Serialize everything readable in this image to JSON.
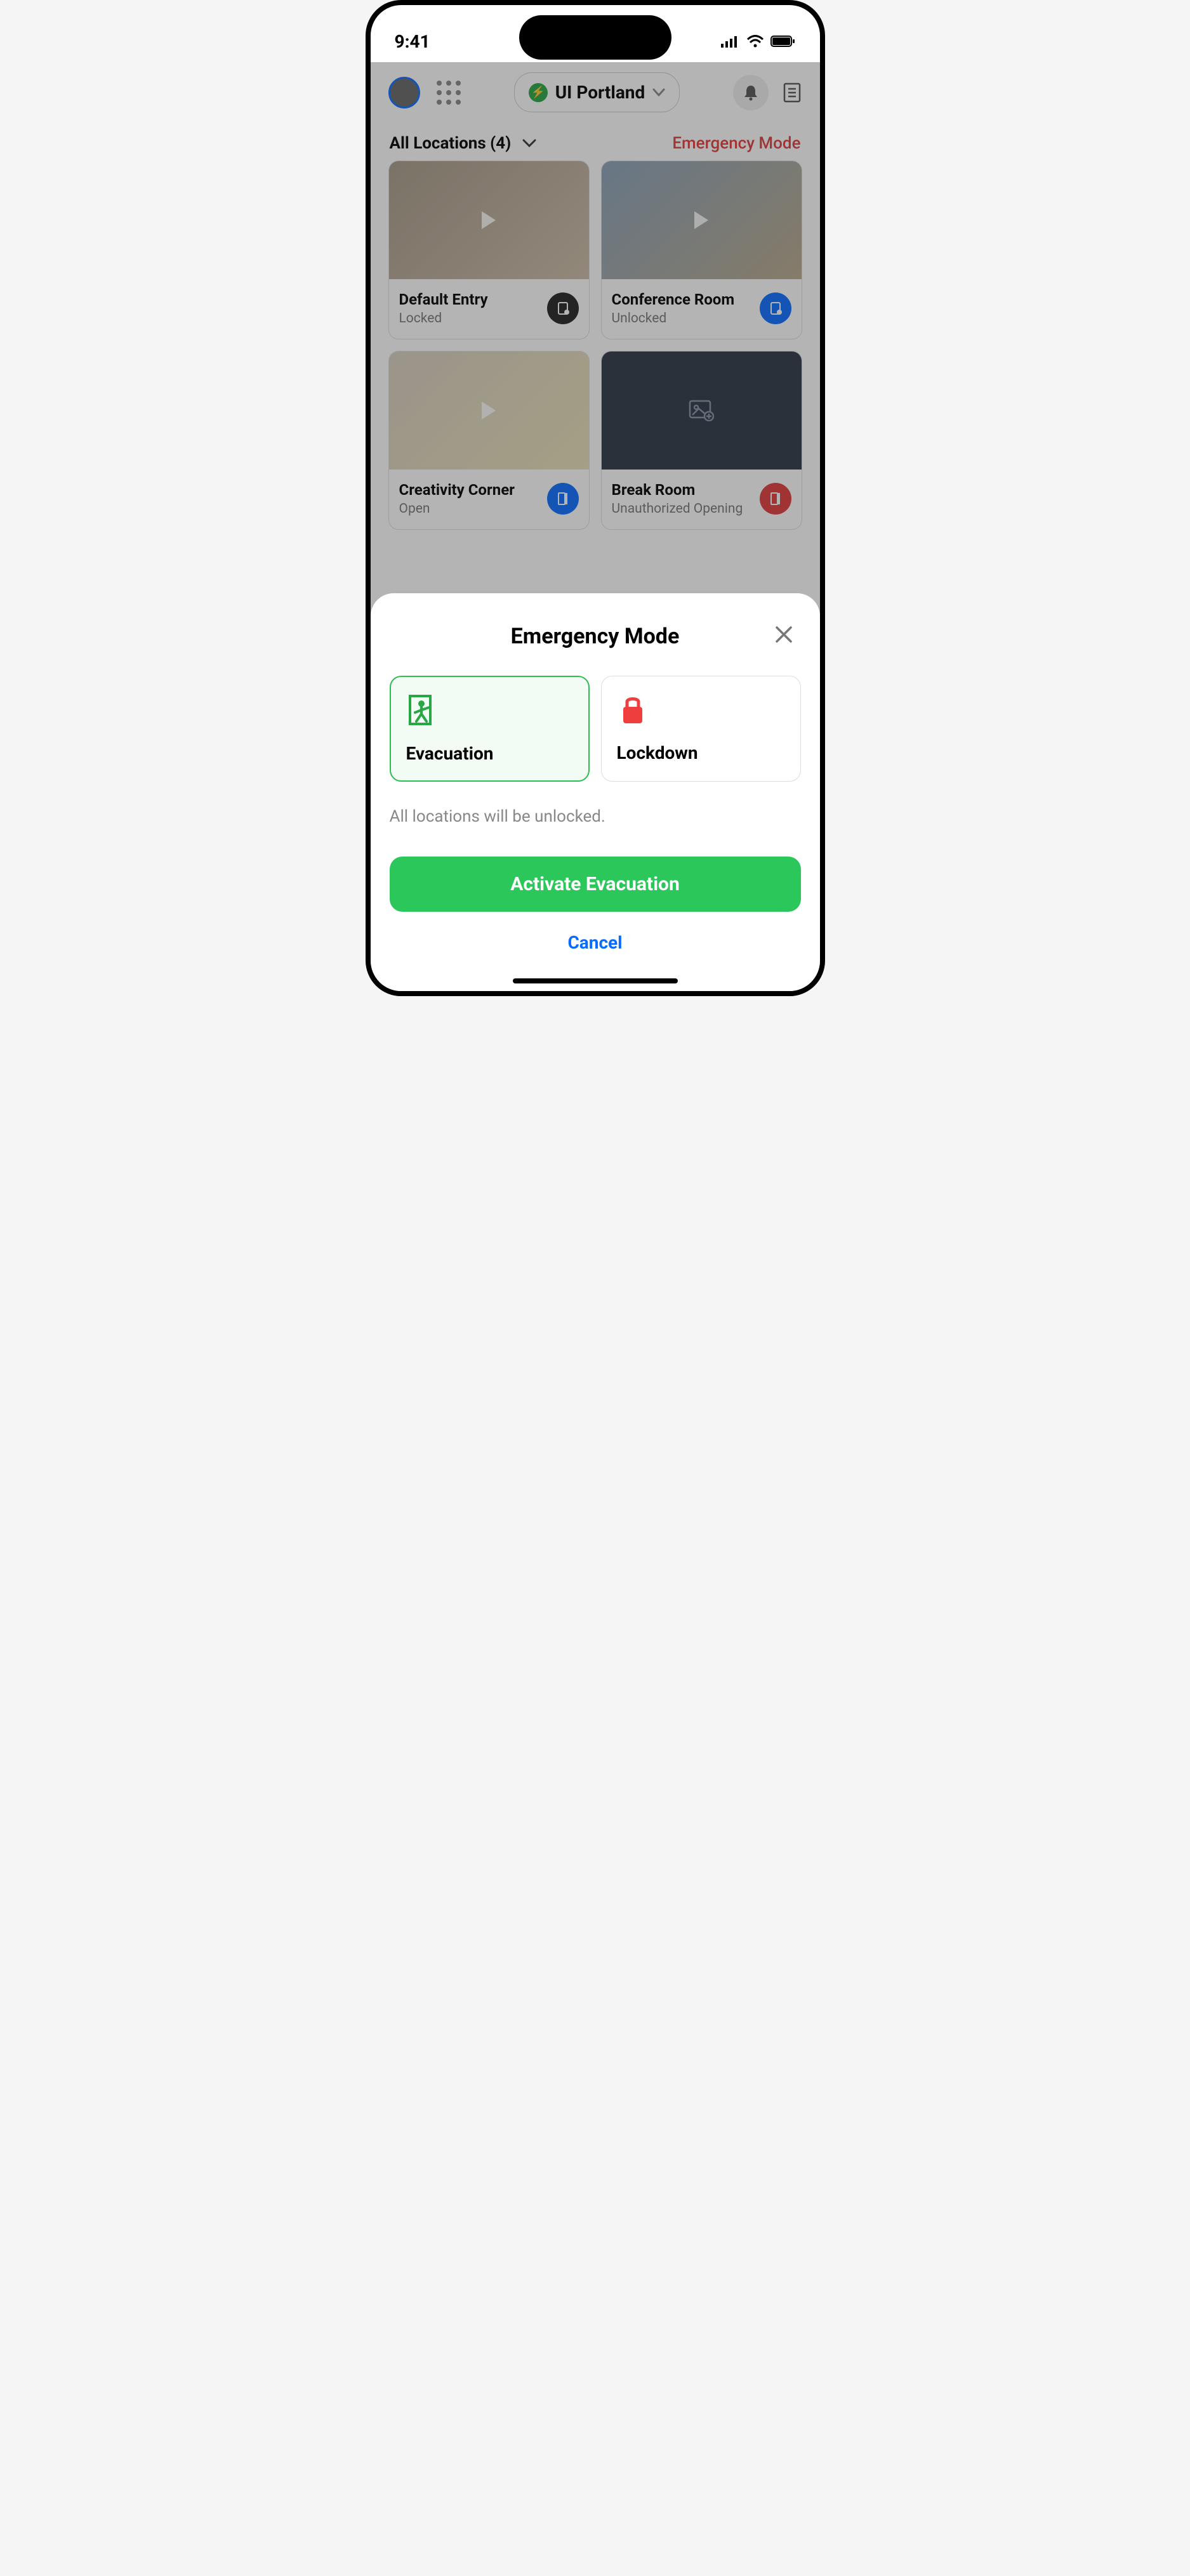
{
  "statusbar": {
    "time": "9:41"
  },
  "topbar": {
    "site_label": "UI Portland"
  },
  "filter": {
    "all_locations_label": "All Locations (4)",
    "emergency_link": "Emergency Mode"
  },
  "cards": [
    {
      "name": "Default Entry",
      "state": "Locked",
      "btn_color": "black",
      "thumb": "a"
    },
    {
      "name": "Conference Room",
      "state": "Unlocked",
      "btn_color": "blue",
      "thumb": "b"
    },
    {
      "name": "Creativity Corner",
      "state": "Open",
      "btn_color": "blue",
      "thumb": "c"
    },
    {
      "name": "Break Room",
      "state": "Unauthorized Opening",
      "btn_color": "red",
      "thumb": "d"
    }
  ],
  "sheet": {
    "title": "Emergency Mode",
    "option_evacuation": "Evacuation",
    "option_lockdown": "Lockdown",
    "description": "All locations will be unlocked.",
    "primary_button": "Activate Evacuation",
    "cancel_button": "Cancel"
  }
}
